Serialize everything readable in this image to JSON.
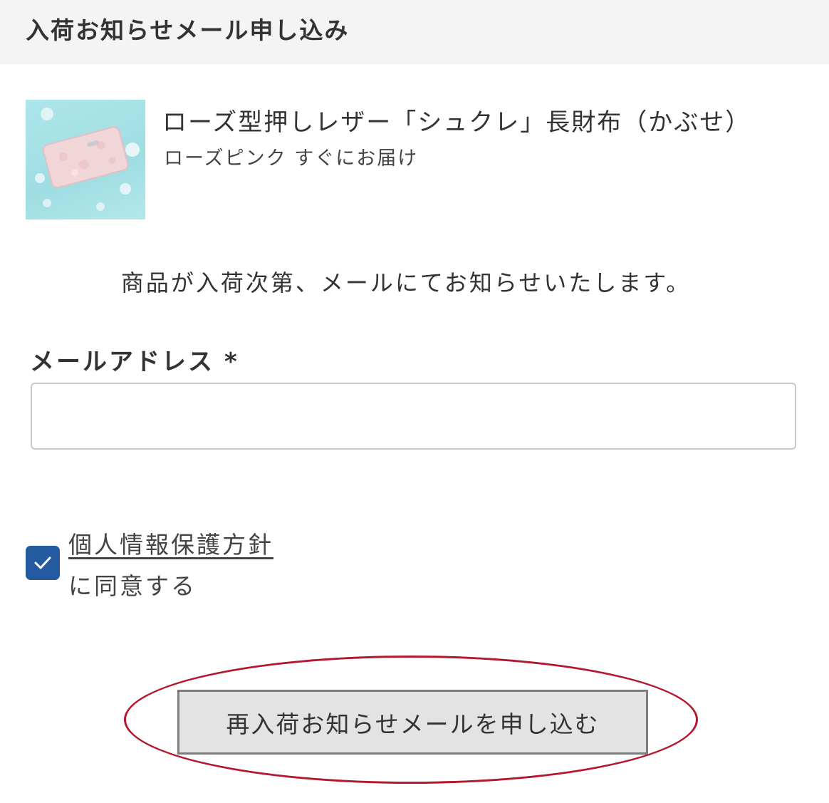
{
  "header": {
    "title": "入荷お知らせメール申し込み"
  },
  "product": {
    "name": "ローズ型押しレザー「シュクレ」長財布（かぶせ）",
    "variant": "ローズピンク すぐにお届け",
    "image_icon": "product-wallet-photo"
  },
  "notice": "商品が入荷次第、メールにてお知らせいたします。",
  "form": {
    "email_label": "メールアドレス",
    "required_mark": "*",
    "email_value": "",
    "checkbox_checked": true,
    "policy_link": "個人情報保護方針",
    "agree_text": "に同意する",
    "submit_label": "再入荷お知らせメールを申し込む"
  },
  "colors": {
    "header_bg": "#f4f4f4",
    "checkbox": "#235aa0",
    "highlight_ellipse": "#b4182e",
    "button_bg": "#e3e3e3"
  }
}
